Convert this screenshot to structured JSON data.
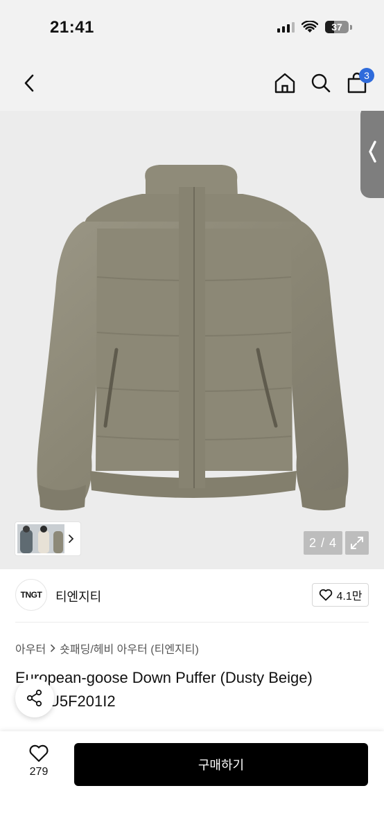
{
  "status_bar": {
    "time": "21:41",
    "battery": "37"
  },
  "header": {
    "back_icon": "chevron-left-icon",
    "home_icon": "home-icon",
    "search_icon": "search-icon",
    "cart_icon": "shopping-bag-icon",
    "cart_count": "3"
  },
  "gallery": {
    "current": 2,
    "total": 4,
    "indicator": "2 / 4",
    "expand_icon": "expand-icon",
    "thumb_chevron_icon": "chevron-right-icon"
  },
  "brand": {
    "logo_text": "TNGT",
    "name": "티엔지티",
    "likes": "4.1만"
  },
  "breadcrumb": {
    "category": "아우터",
    "subcategory": "숏패딩/헤비 아우터 (티엔지티)"
  },
  "product": {
    "title": "European-goose Down Puffer (Dusty Beige)",
    "code": "U5F201I2"
  },
  "bottom_bar": {
    "wish_count": "279",
    "buy_label": "구매하기"
  },
  "colors": {
    "accent_badge": "#2f6bdb",
    "jacket": "#8e8a79",
    "buy_button": "#000000"
  }
}
